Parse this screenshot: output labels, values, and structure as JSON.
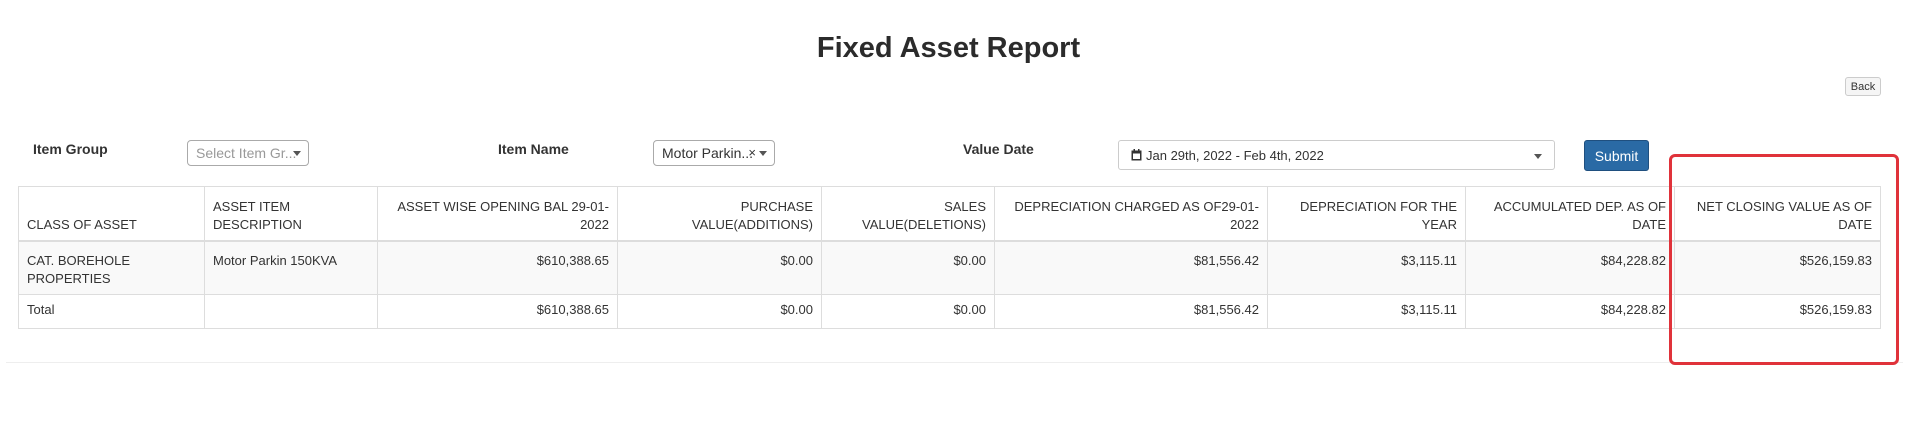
{
  "title": "Fixed Asset Report",
  "back_label": "Back",
  "filters": {
    "item_group": {
      "label": "Item Group",
      "placeholder": "Select Item Gr..."
    },
    "item_name": {
      "label": "Item Name",
      "value": "Motor Parkin...",
      "clear": "×"
    },
    "value_date": {
      "label": "Value Date",
      "value": "Jan 29th, 2022 - Feb 4th, 2022"
    }
  },
  "submit_label": "Submit",
  "table": {
    "columns": [
      "CLASS OF ASSET",
      "ASSET ITEM DESCRIPTION",
      "ASSET WISE OPENING BAL 29-01-2022",
      "PURCHASE VALUE(ADDITIONS)",
      "SALES VALUE(DELETIONS)",
      "DEPRECIATION CHARGED AS OF29-01-2022",
      "DEPRECIATION FOR THE YEAR",
      "ACCUMULATED DEP. AS OF DATE",
      "NET CLOSING VALUE AS OF DATE"
    ],
    "rows": [
      [
        "CAT. BOREHOLE PROPERTIES",
        "Motor Parkin 150KVA",
        "$610,388.65",
        "$0.00",
        "$0.00",
        "$81,556.42",
        "$3,115.11",
        "$84,228.82",
        "$526,159.83"
      ]
    ],
    "total": [
      "Total",
      "",
      "$610,388.65",
      "$0.00",
      "$0.00",
      "$81,556.42",
      "$3,115.11",
      "$84,228.82",
      "$526,159.83"
    ]
  },
  "colors": {
    "submit": "#2a6aa5",
    "highlight": "#e0323a"
  }
}
